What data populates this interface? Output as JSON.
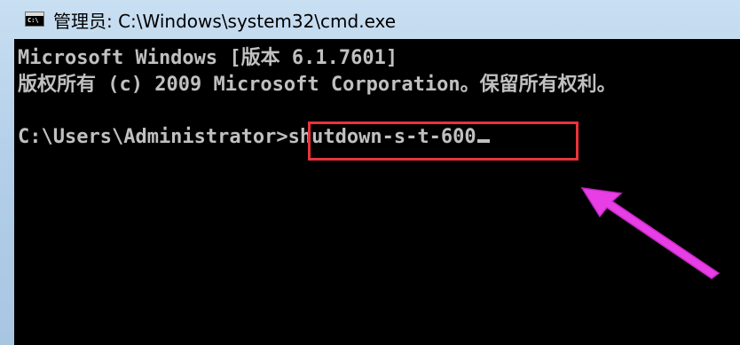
{
  "window": {
    "title": "管理员: C:\\Windows\\system32\\cmd.exe",
    "icon": "cmd-icon",
    "icon_label": "C:\\"
  },
  "console": {
    "line1": "Microsoft Windows [版本 6.1.7601]",
    "line2": "版权所有 (c) 2009 Microsoft Corporation。保留所有权利。",
    "prompt": "C:\\Users\\Administrator>",
    "command": "shutdown-s-t-600",
    "text_color": "#c0c0c0",
    "background": "#000000"
  },
  "annotation": {
    "highlight_color": "#e8333b",
    "arrow_color": "#e83ee6"
  }
}
